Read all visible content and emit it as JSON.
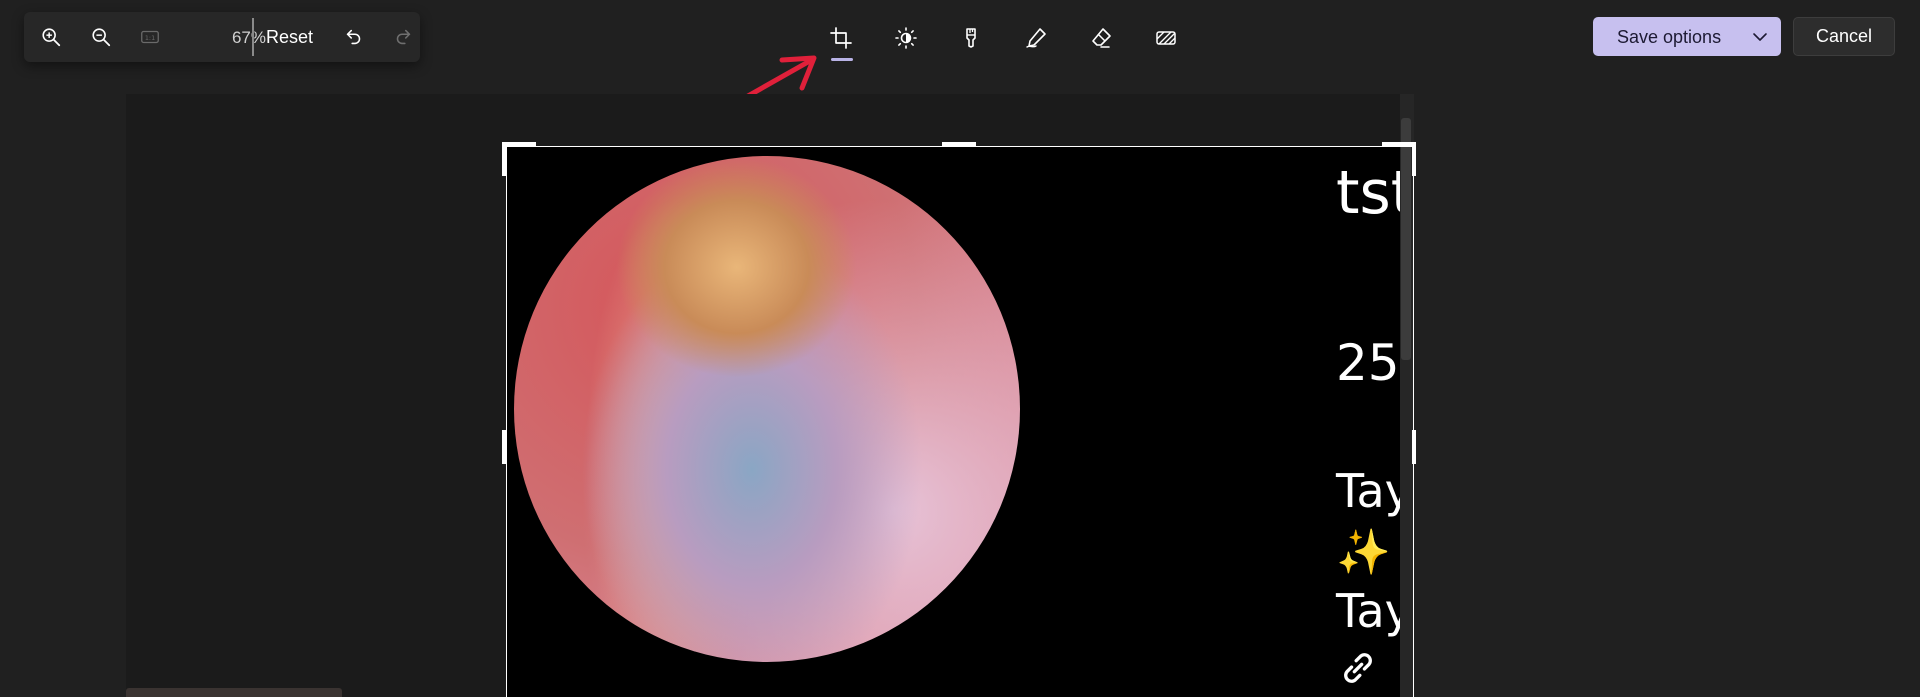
{
  "left_toolbar": {
    "zoom_in_icon": "zoom-in-icon",
    "zoom_out_icon": "zoom-out-icon",
    "actual_size_icon": "actual-size-icon",
    "actual_size_label": "1:1",
    "zoom_level": "67%",
    "reset_label": "Reset",
    "undo_icon": "undo-icon",
    "redo_icon": "redo-icon"
  },
  "tools": [
    {
      "name": "crop",
      "icon": "crop-icon",
      "active": true
    },
    {
      "name": "adjust",
      "icon": "brightness-icon"
    },
    {
      "name": "filter",
      "icon": "filter-icon"
    },
    {
      "name": "markup",
      "icon": "pen-icon"
    },
    {
      "name": "erase",
      "icon": "eraser-icon"
    },
    {
      "name": "background",
      "icon": "background-icon"
    }
  ],
  "actions": {
    "save_label": "Save options",
    "cancel_label": "Cancel"
  },
  "image_text": {
    "username": "tst",
    "count": "25",
    "name_line1": "Tay",
    "sparkle": "✨",
    "name_line2": "Tay",
    "link_icon": "link-icon"
  },
  "colors": {
    "background": "#202020",
    "accent": "#c7c0ef",
    "annotation_arrow": "#e0203a"
  }
}
